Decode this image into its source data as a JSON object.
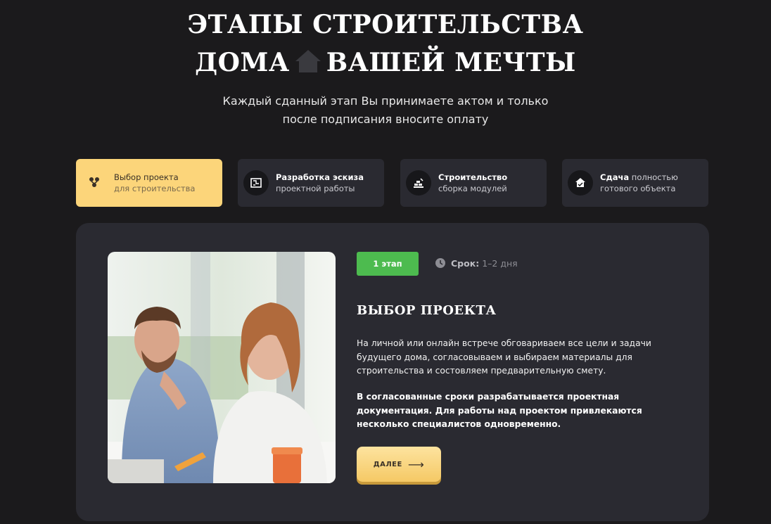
{
  "header": {
    "title_line1": "ЭТАПЫ СТРОИТЕЛЬСТВА",
    "title_line2_before": "ДОМА",
    "title_line2_after": "ВАШЕЙ МЕЧТЫ",
    "title_icon": "house-icon",
    "subtitle_line1": "Каждый сданный этап Вы принимаете актом и только",
    "subtitle_line2": "после подписания вносите оплату"
  },
  "tabs": [
    {
      "bold": "",
      "title": "Выбор проекта",
      "sub": "для строительства",
      "icon": "people-icon",
      "active": true
    },
    {
      "bold": "Разработка эскиза",
      "title": "",
      "sub": "проектной работы",
      "icon": "blueprint-icon",
      "active": false
    },
    {
      "bold": "Строительство",
      "title": "",
      "sub": "сборка модулей",
      "icon": "bricks-icon",
      "active": false
    },
    {
      "bold": "Сдача",
      "title": " полностью",
      "sub": "готового объекта",
      "icon": "house-check-icon",
      "active": false
    }
  ],
  "stage": {
    "badge": "1 этап",
    "term_label": "Срок:",
    "term_value": "1–2 дня",
    "title": "ВЫБОР ПРОЕКТА",
    "description": "На личной или онлайн встрече обговариваем все цели и задачи будущего дома, согласовываем и выбираем материалы для строительства и состовляем предварительную смету.",
    "description_bold": "В согласованные сроки разрабатывается проектная документация. Для работы над проектом привлекаются несколько специалистов одновременно.",
    "next_label": "ДАЛЕЕ",
    "next_arrow": "⟶"
  },
  "colors": {
    "background": "#1b1a1c",
    "panel": "#2a2a31",
    "accent": "#fcd57a",
    "badge_green": "#4dbb4f"
  }
}
